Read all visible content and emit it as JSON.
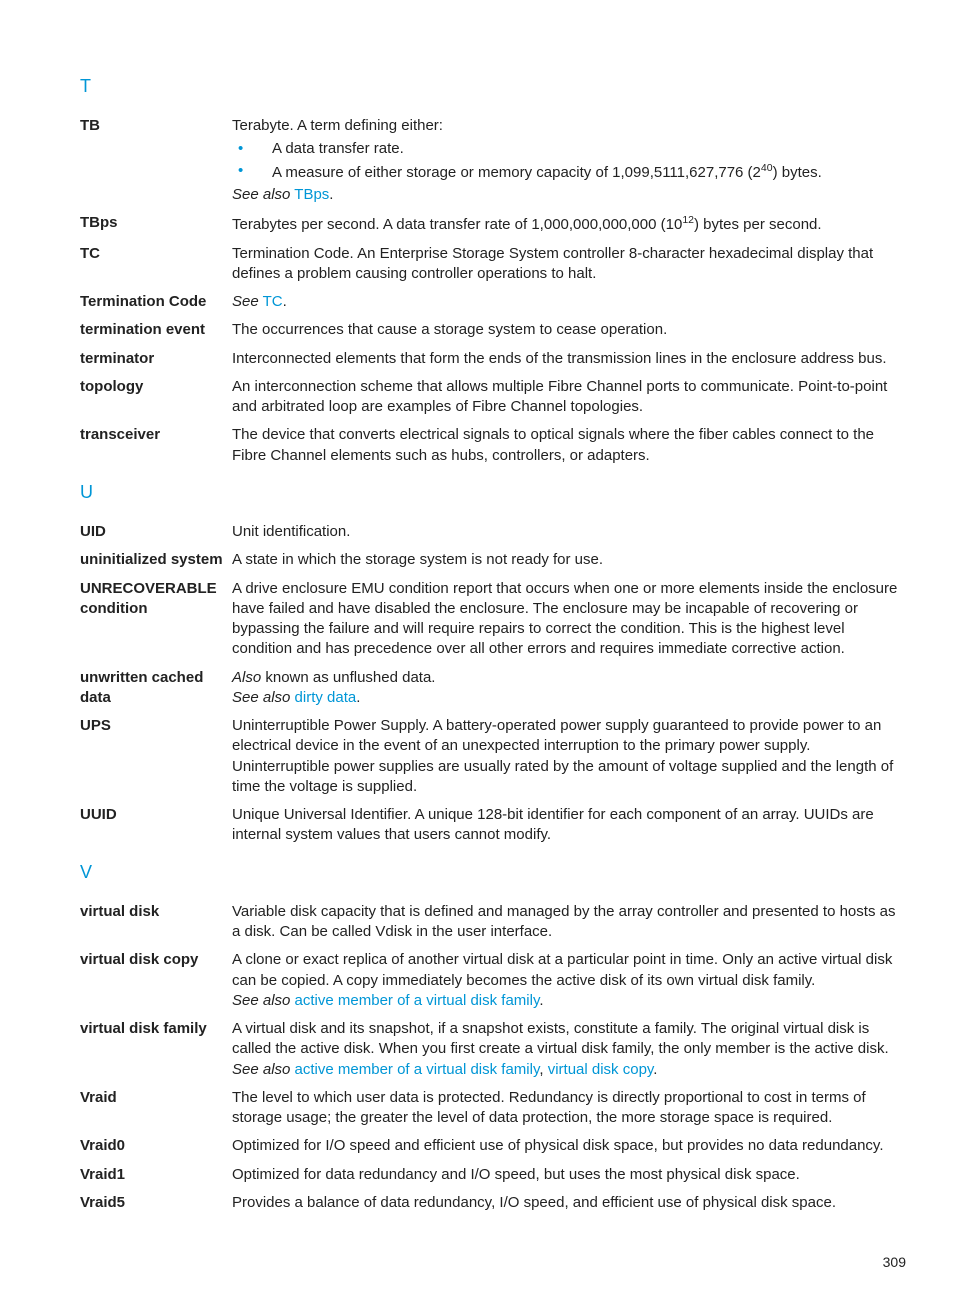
{
  "sections": {
    "t": {
      "heading": "T",
      "entries": {
        "tb": {
          "term": "TB",
          "lead": "Terabyte. A term defining either:",
          "bullets": [
            "A data transfer rate.",
            "A measure of either storage or memory capacity of 1,099,5111,627,776 (2^40) bytes."
          ],
          "seealso_label": "See also",
          "seealso_link": "TBps",
          "tail": "."
        },
        "tbps": {
          "term": "TBps",
          "def": "Terabytes per second. A data transfer rate of 1,000,000,000,000 (10^12) bytes per second."
        },
        "tc": {
          "term": "TC",
          "def": "Termination Code. An Enterprise Storage System controller 8-character hexadecimal display that defines a problem causing controller operations to halt."
        },
        "termination_code": {
          "term": "Termination Code",
          "see_label": "See",
          "see_link": "TC",
          "tail": "."
        },
        "termination_event": {
          "term": "termination event",
          "def": "The occurrences that cause a storage system to cease operation."
        },
        "terminator": {
          "term": "terminator",
          "def": "Interconnected elements that form the ends of the transmission lines in the enclosure address bus."
        },
        "topology": {
          "term": "topology",
          "def": "An interconnection scheme that allows multiple Fibre Channel ports to communicate. Point-to-point and arbitrated loop are examples of Fibre Channel topologies."
        },
        "transceiver": {
          "term": "transceiver",
          "def": "The device that converts electrical signals to optical signals where the fiber cables connect to the Fibre Channel elements such as hubs, controllers, or adapters."
        }
      }
    },
    "u": {
      "heading": "U",
      "entries": {
        "uid": {
          "term": "UID",
          "def": "Unit identification."
        },
        "uninit": {
          "term": "uninitialized system",
          "def": "A state in which the storage system is not ready for use."
        },
        "unrec": {
          "term": "UNRECOVERABLE condition",
          "def": "A drive enclosure EMU condition report that occurs when one or more elements inside the enclosure have failed and have disabled the enclosure. The enclosure may be incapable of recovering or bypassing the failure and will require repairs to correct the condition. This is the highest level condition and has precedence over all other errors and requires immediate corrective action."
        },
        "unwritten": {
          "term": "unwritten cached data",
          "also_label": "Also",
          "also_text": " known as unflushed data.",
          "seealso_label": "See also",
          "seealso_link": "dirty data",
          "tail": "."
        },
        "ups": {
          "term": "UPS",
          "def": "Uninterruptible Power Supply. A battery-operated power supply guaranteed to provide power to an electrical device in the event of an unexpected interruption to the primary power supply. Uninterruptible power supplies are usually rated by the amount of voltage supplied and the length of time the voltage is supplied."
        },
        "uuid": {
          "term": "UUID",
          "def": "Unique Universal Identifier. A unique 128-bit identifier for each component of an array. UUIDs are internal system values that users cannot modify."
        }
      }
    },
    "v": {
      "heading": "V",
      "entries": {
        "vdisk": {
          "term": "virtual disk",
          "def": "Variable disk capacity that is defined and managed by the array controller and presented to hosts as a disk. Can be called Vdisk in the user interface."
        },
        "vdcopy": {
          "term": "virtual disk copy",
          "def": "A clone or exact replica of another virtual disk at a particular point in time. Only an active virtual disk can be copied. A copy immediately becomes the active disk of its own virtual disk family.",
          "seealso_label": "See also",
          "seealso_link": "active member of a virtual disk family",
          "tail": "."
        },
        "vdfam": {
          "term": "virtual disk family",
          "def": "A virtual disk and its snapshot, if a snapshot exists, constitute a family. The original virtual disk is called the active disk. When you first create a virtual disk family, the only member is the active disk.",
          "seealso_label": "See also",
          "seealso_link1": "active member of a virtual disk family",
          "sep": ", ",
          "seealso_link2": "virtual disk copy",
          "tail": "."
        },
        "vraid": {
          "term": "Vraid",
          "def": "The level to which user data is protected. Redundancy is directly proportional to cost in terms of storage usage; the greater the level of data protection, the more storage space is required."
        },
        "vraid0": {
          "term": "Vraid0",
          "def": "Optimized for I/O speed and efficient use of physical disk space, but provides no data redundancy."
        },
        "vraid1": {
          "term": "Vraid1",
          "def": "Optimized for data redundancy and I/O speed, but uses the most physical disk space."
        },
        "vraid5": {
          "term": "Vraid5",
          "def": "Provides a balance of data redundancy, I/O speed, and efficient use of physical disk space."
        }
      }
    }
  },
  "page_number": "309"
}
